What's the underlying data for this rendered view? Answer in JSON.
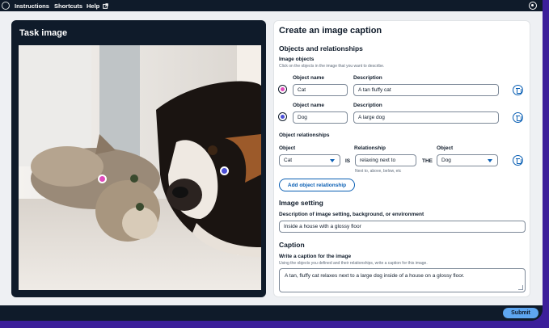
{
  "topbar": {
    "instructions": "Instructions",
    "shortcuts": "Shortcuts",
    "help": "Help"
  },
  "left": {
    "title": "Task image"
  },
  "markers": [
    {
      "name": "cat",
      "color": "#e04bbd"
    },
    {
      "name": "dog",
      "color": "#4b4fd6"
    }
  ],
  "form": {
    "title": "Create an image caption",
    "objects_section": "Objects and relationships",
    "image_objects_label": "Image objects",
    "image_objects_hint": "Click on the objects in the image that you want to describe.",
    "objects": [
      {
        "name_label": "Object name",
        "desc_label": "Description",
        "name": "Cat",
        "description": "A tan fluffy cat",
        "color": "#e04bbd"
      },
      {
        "name_label": "Object name",
        "desc_label": "Description",
        "name": "Dog",
        "description": "A large dog",
        "color": "#4b4fd6"
      }
    ],
    "relationships_label": "Object relationships",
    "rel": {
      "object_label": "Object",
      "relationship_label": "Relationship",
      "object2_label": "Object",
      "object1": "Cat",
      "is": "IS",
      "relationship": "relaxing next to",
      "the": "THE",
      "object2": "Dog",
      "hint": "Next to, above, below, etc"
    },
    "add_relationship": "Add object relationship",
    "setting_title": "Image setting",
    "setting_label": "Description of image setting, background, or environment",
    "setting_value": "Inside a house with a glossy floor",
    "caption_title": "Caption",
    "caption_label": "Write a caption for the image",
    "caption_hint": "Using the objects you defined and their relationships, write a caption for this image.",
    "caption_value": "A tan, fluffy cat relaxes next to a large dog inside of a house on a glossy floor."
  },
  "submit": "Submit"
}
